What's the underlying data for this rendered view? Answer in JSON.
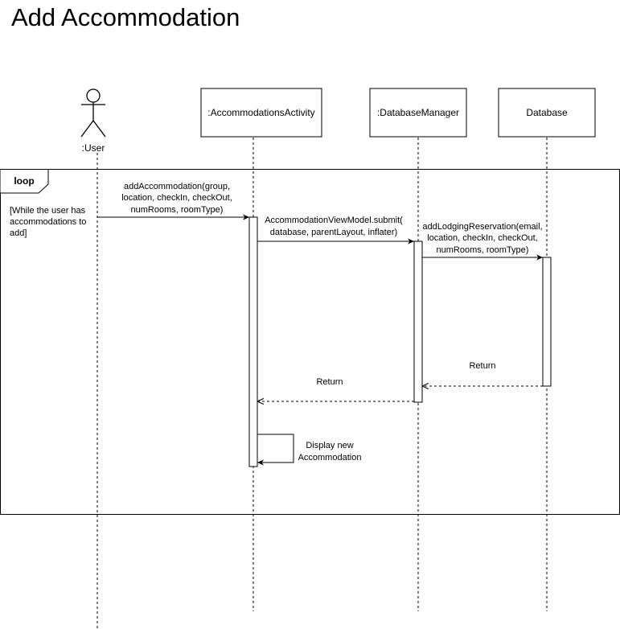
{
  "title": "Add Accommodation",
  "colors": {
    "stroke": "#000000",
    "background": "#ffffff"
  },
  "participants": [
    {
      "label": ":User",
      "type": "actor"
    },
    {
      "label": ":AccommodationsActivity",
      "type": "object"
    },
    {
      "label": ":DatabaseManager",
      "type": "object"
    },
    {
      "label": "Database",
      "type": "object"
    }
  ],
  "loop": {
    "label": "loop",
    "guard": [
      "[While the user has",
      "accommodations to",
      "add]"
    ]
  },
  "messages": {
    "add_accommodation": [
      "addAccommodation(group,",
      "location, checkIn, checkOut,",
      "numRooms, roomType)"
    ],
    "submit": [
      "AccommodationViewModel.submit(",
      "database, parentLayout, inflater)"
    ],
    "add_lodging": [
      "addLodgingReservation(email,",
      "location, checkIn, checkOut,",
      "numRooms, roomType)"
    ],
    "return_database": "Return",
    "return_manager": "Return",
    "display": [
      "Display new",
      "Accommodation"
    ]
  }
}
